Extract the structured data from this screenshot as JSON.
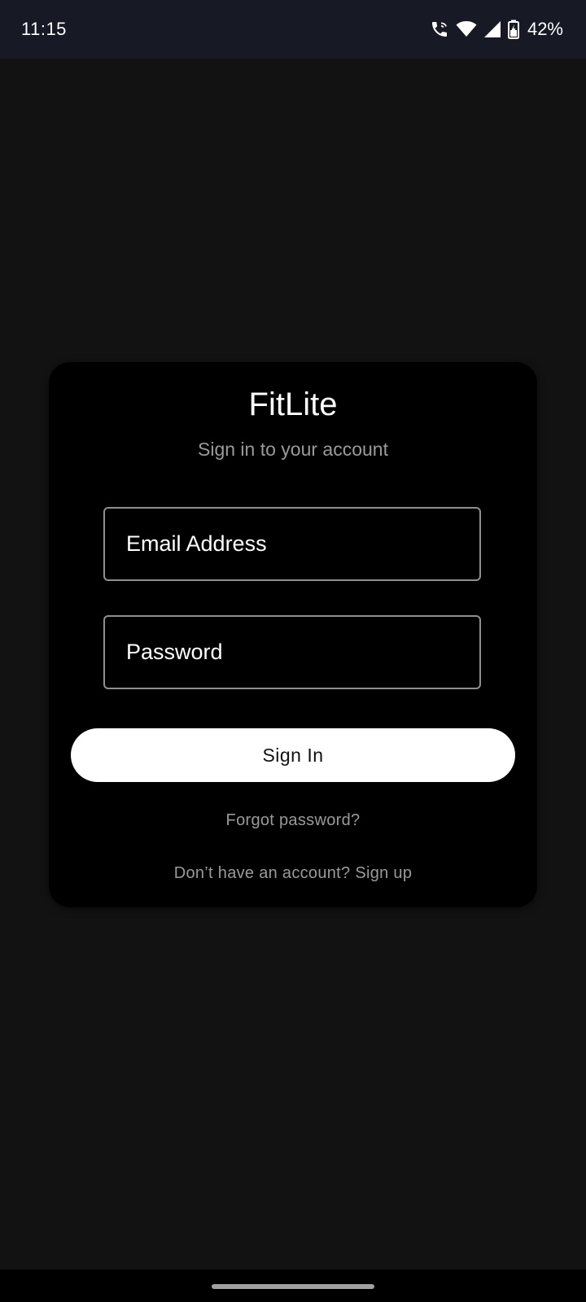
{
  "status_bar": {
    "time": "11:15",
    "battery": "42%",
    "icons": [
      "wifi-calling-icon",
      "wifi-icon",
      "cellular-signal-icon",
      "battery-charging-icon"
    ]
  },
  "login": {
    "app_name": "FitLite",
    "subtitle": "Sign in to your account",
    "email_placeholder": "Email Address",
    "email_value": "",
    "password_placeholder": "Password",
    "password_value": "",
    "sign_in_label": "Sign In",
    "forgot_password": "Forgot password?",
    "no_account_text": "Don’t have an account?",
    "sign_up_label": "Sign up"
  },
  "colors": {
    "background": "#121212",
    "card": "#000000",
    "status_bar": "#171a24",
    "button": "#ffffff",
    "muted_text": "#9a9a9a",
    "field_border": "#8f8f8f"
  }
}
